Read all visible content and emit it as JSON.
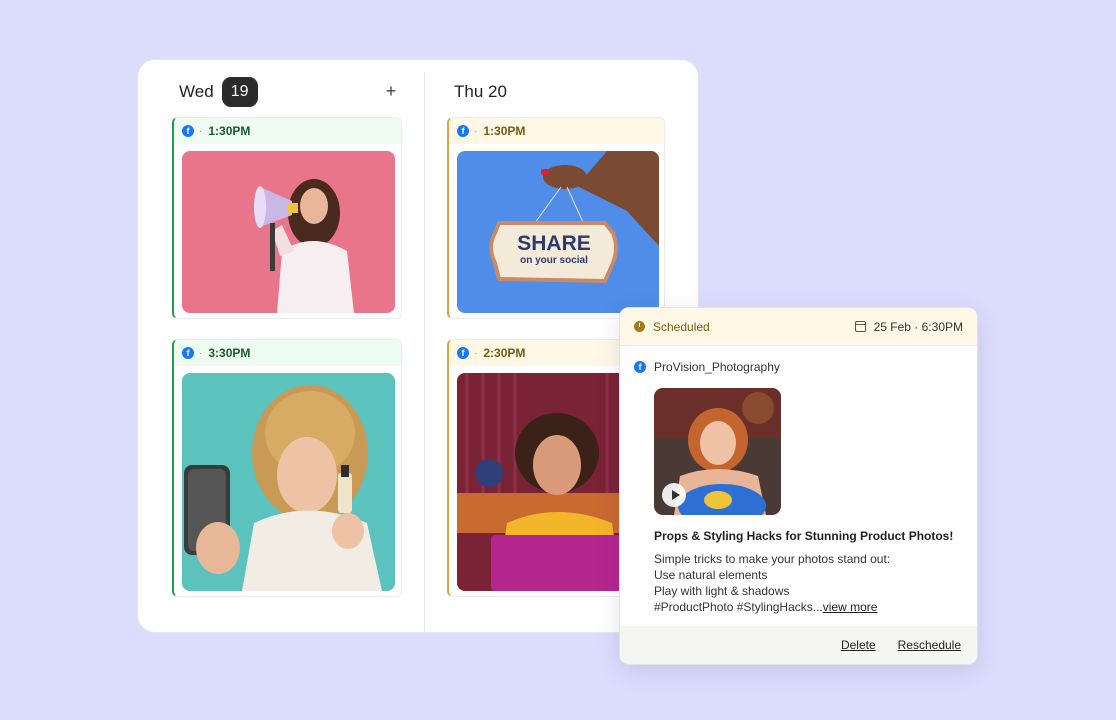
{
  "calendar": {
    "wed": {
      "day": "Wed",
      "num": "19",
      "add": "+"
    },
    "thu": {
      "day": "Thu 20"
    },
    "posts": [
      {
        "time": "1:30PM",
        "dot": "·"
      },
      {
        "time": "3:30PM",
        "dot": "·"
      },
      {
        "time": "1:30PM",
        "dot": "·"
      },
      {
        "time": "2:30PM",
        "dot": "·"
      }
    ],
    "sign": {
      "line1": "SHARE",
      "line2": "on your social"
    }
  },
  "card": {
    "status": "Scheduled",
    "date": "25 Feb · 6:30PM",
    "account": "ProVision_Photography",
    "title": "Props & Styling Hacks for Stunning Product Photos!",
    "desc_lines": [
      "Simple tricks to make your photos stand out:",
      "Use natural elements",
      "Play with light & shadows",
      "#ProductPhoto #StylingHacks..."
    ],
    "view_more": "view more",
    "delete": "Delete",
    "reschedule": "Reschedule"
  },
  "icons": {
    "facebook": "f"
  },
  "colors": {
    "background": "#dcdcfd",
    "green_accent": "#1f9d55",
    "amber_accent": "#d9a441",
    "facebook": "#1877f2"
  }
}
